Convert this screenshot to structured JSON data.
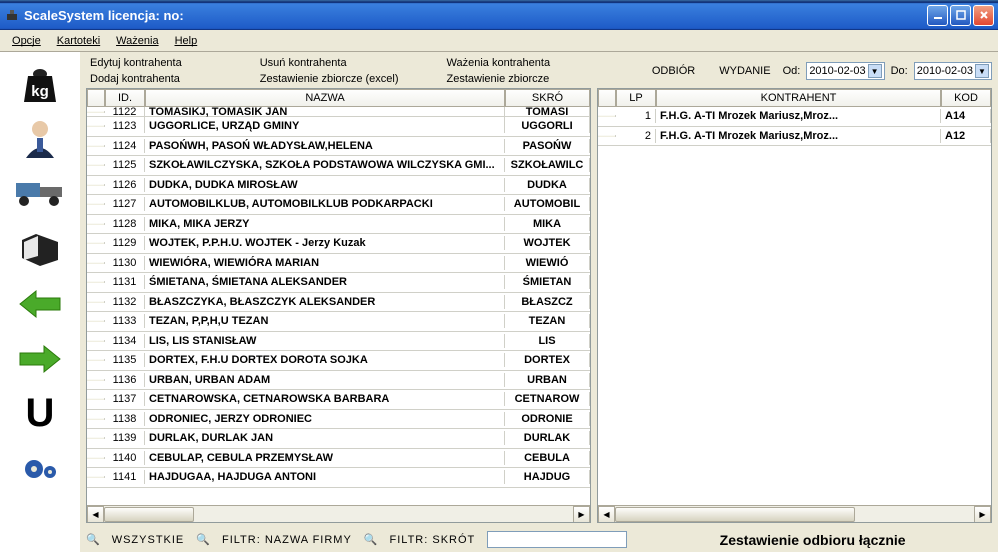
{
  "window": {
    "title": "ScaleSystem licencja:  no:"
  },
  "menu": {
    "opcje": "Opcje",
    "kartoteki": "Kartoteki",
    "wazenia": "Ważenia",
    "help": "Help"
  },
  "actions": {
    "edytuj": "Edytuj kontrahenta",
    "dodaj": "Dodaj kontrahenta",
    "usun": "Usuń kontrahenta",
    "zestExcel": "Zestawienie zbiorcze (excel)",
    "wazenia": "Ważenia kontrahenta",
    "zest": "Zestawienie zbiorcze"
  },
  "filters": {
    "odbior": "ODBIÓR",
    "wydanie": "WYDANIE",
    "od": "Od:",
    "do": "Do:",
    "dateFrom": "2010-02-03",
    "dateTo": "2010-02-03"
  },
  "leftGrid": {
    "headers": {
      "id": "ID.",
      "nazwa": "NAZWA",
      "skrot": "SKRÓ"
    },
    "rows": [
      {
        "id": "1122",
        "nazwa": "TOMASIKJ, TOMASIK JAN",
        "skrot": "TOMASI"
      },
      {
        "id": "1123",
        "nazwa": "UGGORLICE, URZĄD GMINY",
        "skrot": "UGGORLI"
      },
      {
        "id": "1124",
        "nazwa": "PASOŃWH, PASOŃ WŁADYSŁAW,HELENA",
        "skrot": "PASOŃW"
      },
      {
        "id": "1125",
        "nazwa": "SZKOŁAWILCZYSKA, SZKOŁA PODSTAWOWA WILCZYSKA GMI...",
        "skrot": "SZKOŁAWILC"
      },
      {
        "id": "1126",
        "nazwa": "DUDKA, DUDKA MIROSŁAW",
        "skrot": "DUDKA"
      },
      {
        "id": "1127",
        "nazwa": "AUTOMOBILKLUB, AUTOMOBILKLUB PODKARPACKI",
        "skrot": "AUTOMOBIL"
      },
      {
        "id": "1128",
        "nazwa": "MIKA, MIKA JERZY",
        "skrot": "MIKA"
      },
      {
        "id": "1129",
        "nazwa": "WOJTEK, P.P.H.U.  WOJTEK  - Jerzy Kuzak",
        "skrot": "WOJTEK"
      },
      {
        "id": "1130",
        "nazwa": "WIEWIÓRA, WIEWIÓRA MARIAN",
        "skrot": "WIEWIÓ"
      },
      {
        "id": "1131",
        "nazwa": "ŚMIETANA, ŚMIETANA ALEKSANDER",
        "skrot": "ŚMIETAN"
      },
      {
        "id": "1132",
        "nazwa": "BŁASZCZYKA, BŁASZCZYK ALEKSANDER",
        "skrot": "BŁASZCZ"
      },
      {
        "id": "1133",
        "nazwa": "TEZAN, P,P,H,U  TEZAN",
        "skrot": "TEZAN"
      },
      {
        "id": "1134",
        "nazwa": "LIS, LIS STANISŁAW",
        "skrot": "LIS"
      },
      {
        "id": "1135",
        "nazwa": "DORTEX, F.H.U  DORTEX  DOROTA SOJKA",
        "skrot": "DORTEX"
      },
      {
        "id": "1136",
        "nazwa": "URBAN, URBAN ADAM",
        "skrot": "URBAN"
      },
      {
        "id": "1137",
        "nazwa": "CETNAROWSKA, CETNAROWSKA BARBARA",
        "skrot": "CETNAROW"
      },
      {
        "id": "1138",
        "nazwa": "ODRONIEC, JERZY ODRONIEC",
        "skrot": "ODRONIE"
      },
      {
        "id": "1139",
        "nazwa": "DURLAK, DURLAK JAN",
        "skrot": "DURLAK"
      },
      {
        "id": "1140",
        "nazwa": "CEBULAP, CEBULA PRZEMYSŁAW",
        "skrot": "CEBULA"
      },
      {
        "id": "1141",
        "nazwa": "HAJDUGAA, HAJDUGA ANTONI",
        "skrot": "HAJDUG"
      }
    ]
  },
  "rightGrid": {
    "headers": {
      "lp": "LP",
      "kontrahent": "KONTRAHENT",
      "kod": "KOD"
    },
    "rows": [
      {
        "lp": "1",
        "kontrahent": "F.H.G.  A-TI  Mrozek Mariusz,Mroz...",
        "kod": "A14"
      },
      {
        "lp": "2",
        "kontrahent": "F.H.G.  A-TI  Mrozek Mariusz,Mroz...",
        "kod": "A12"
      }
    ]
  },
  "bottom": {
    "wszystkie": "WSZYSTKIE",
    "filtrNazwa": "FILTR: NAZWA FIRMY",
    "filtrSkrot": "FILTR: SKRÓT",
    "summary": "Zestawienie odbioru łącznie"
  }
}
